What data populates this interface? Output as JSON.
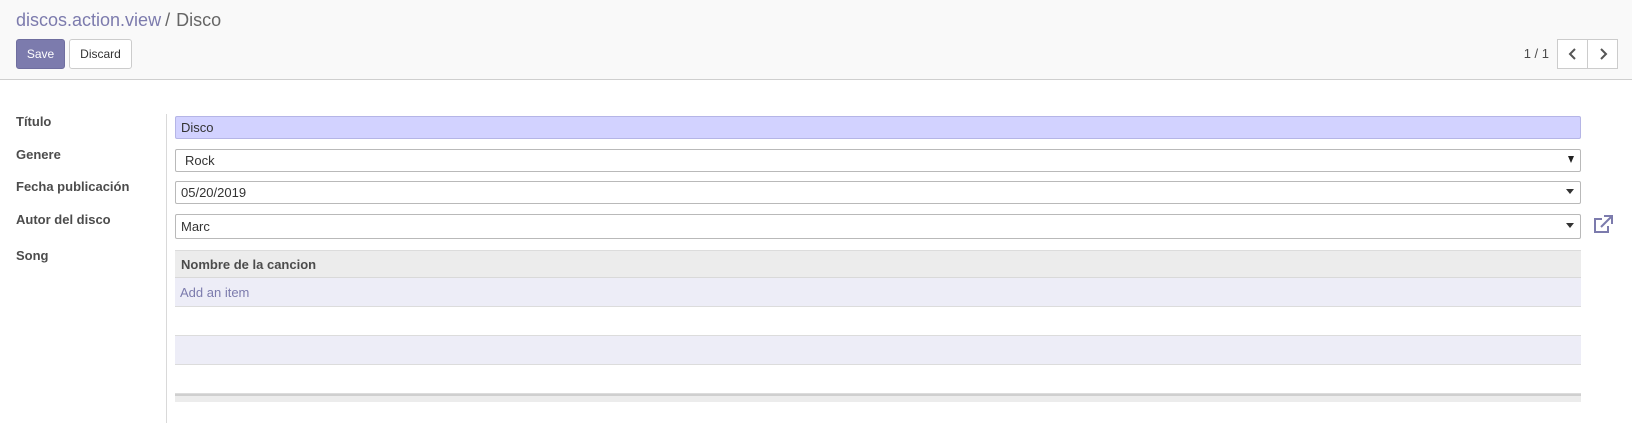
{
  "breadcrumb": {
    "parent": "discos.action.view",
    "separator": "/",
    "current": "Disco"
  },
  "toolbar": {
    "save_label": "Save",
    "discard_label": "Discard"
  },
  "pager": {
    "value": "1 / 1",
    "prev_icon": "chevron-left-icon",
    "next_icon": "chevron-right-icon"
  },
  "form": {
    "titulo": {
      "label": "Título",
      "value": "Disco"
    },
    "genere": {
      "label": "Genere",
      "value": "Rock"
    },
    "fecha": {
      "label": "Fecha publicación",
      "value": "05/20/2019"
    },
    "autor": {
      "label": "Autor del disco",
      "value": "Marc",
      "link_icon": "external-link-icon"
    },
    "song": {
      "label": "Song",
      "column_header": "Nombre de la cancion",
      "add_item_label": "Add an item"
    }
  },
  "colors": {
    "accent": "#7c7bad",
    "required_field": "#d2d2ff",
    "row_stripe": "#ededf7"
  }
}
